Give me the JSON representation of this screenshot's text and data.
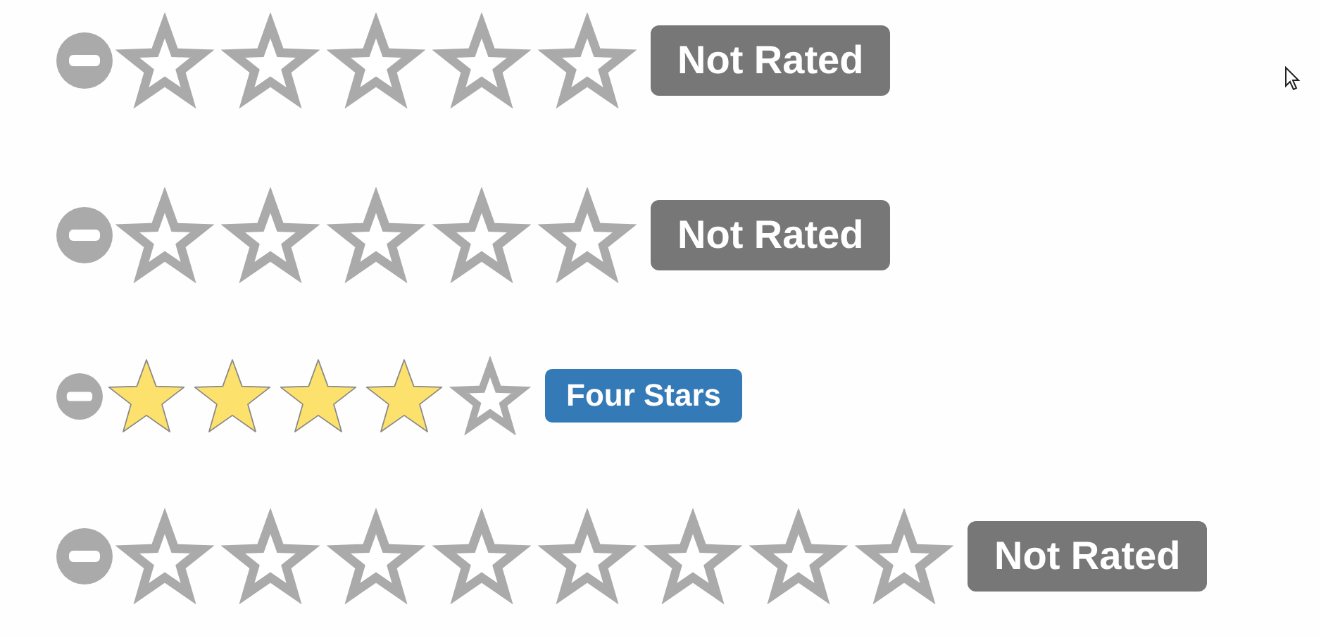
{
  "ratings": [
    {
      "kind": "large",
      "star_slots": [
        {
          "filled": false
        },
        {
          "filled": false
        },
        {
          "filled": false
        },
        {
          "filled": false
        },
        {
          "filled": false
        }
      ],
      "badge": "Not Rated",
      "color": "#777777"
    },
    {
      "kind": "large",
      "star_slots": [
        {
          "filled": false
        },
        {
          "filled": false
        },
        {
          "filled": false
        },
        {
          "filled": false
        },
        {
          "filled": false
        }
      ],
      "badge": "Not Rated",
      "color": "#777777"
    },
    {
      "kind": "small",
      "star_slots": [
        {
          "filled": true
        },
        {
          "filled": true
        },
        {
          "filled": true
        },
        {
          "filled": true
        },
        {
          "filled": false
        }
      ],
      "badge": "Four Stars",
      "color": "#337ab7"
    },
    {
      "kind": "large",
      "star_slots": [
        {
          "filled": false
        },
        {
          "filled": false
        },
        {
          "filled": false
        },
        {
          "filled": false
        },
        {
          "filled": false
        },
        {
          "filled": false
        },
        {
          "filled": false
        },
        {
          "filled": false
        }
      ],
      "badge": "Not Rated",
      "color": "#777777"
    }
  ]
}
